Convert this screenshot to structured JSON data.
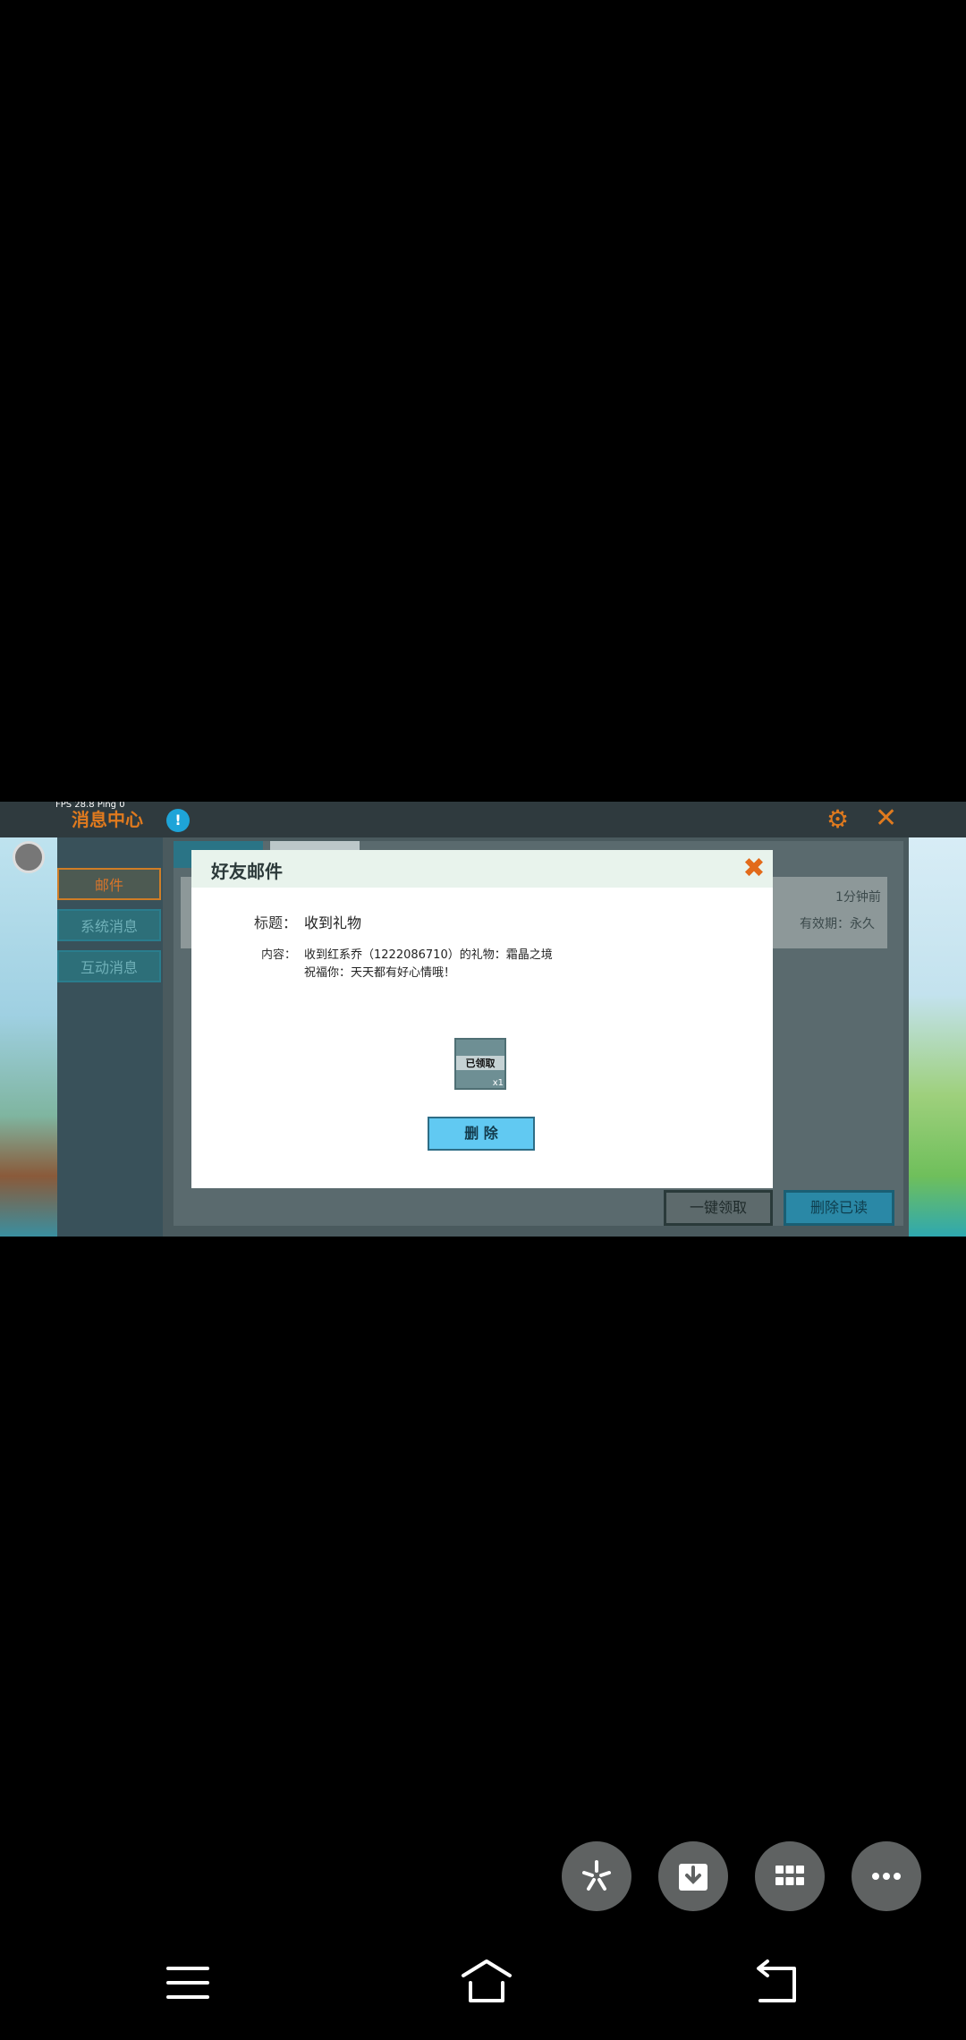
{
  "game": {
    "fps_text": "FPS 28.8  Ping 0",
    "header_title": "消息中心",
    "left_nav": [
      "邮件",
      "系统消息",
      "互动消息"
    ],
    "mail_row": {
      "time": "1分钟前",
      "validity": "有效期：永久"
    },
    "bottom_buttons": {
      "claim_all": "一键领取",
      "delete_read": "删除已读"
    }
  },
  "dialog": {
    "title": "好友邮件",
    "subject_label": "标题：",
    "subject_value": "收到礼物",
    "content_label": "内容：",
    "content_line1": "收到红系乔（1222086710）的礼物：霜晶之境",
    "content_line2": "祝福你：天天都有好心情哦！",
    "gift": {
      "status": "已领取",
      "count": "x1"
    },
    "delete_button": "删 除"
  },
  "toolbar": {
    "icons": [
      "sparkle-icon",
      "download-icon",
      "grid-icon",
      "more-icon"
    ]
  },
  "navbar": {
    "icons": [
      "menu-icon",
      "home-icon",
      "back-icon"
    ]
  },
  "colors": {
    "accent_orange": "#e07a1e",
    "delete_button_blue": "#61c9f2",
    "fab_gray": "#5f6262"
  }
}
